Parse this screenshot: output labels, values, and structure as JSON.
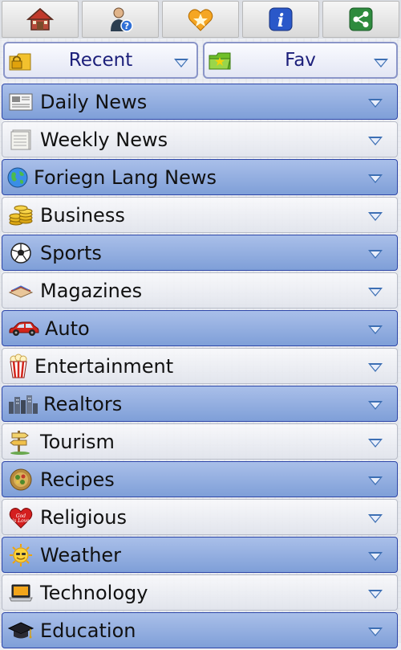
{
  "toolbar": {
    "buttons": [
      {
        "name": "home",
        "icon": "house-icon"
      },
      {
        "name": "help",
        "icon": "person-help-icon"
      },
      {
        "name": "favorites",
        "icon": "star-heart-icon"
      },
      {
        "name": "info",
        "icon": "info-icon"
      },
      {
        "name": "share",
        "icon": "share-icon"
      }
    ]
  },
  "dropdowns": {
    "recent": {
      "label": "Recent",
      "icon": "lock-folder-icon"
    },
    "fav": {
      "label": "Fav",
      "icon": "green-folder-icon"
    }
  },
  "categories": [
    {
      "label": "Daily News",
      "icon": "newspaper-icon"
    },
    {
      "label": "Weekly News",
      "icon": "newspaper-stack-icon"
    },
    {
      "label": "Foriegn Lang News",
      "icon": "globe-icon"
    },
    {
      "label": "Business",
      "icon": "coins-icon"
    },
    {
      "label": "Sports",
      "icon": "soccer-ball-icon"
    },
    {
      "label": "Magazines",
      "icon": "magazine-icon"
    },
    {
      "label": "Auto",
      "icon": "car-icon"
    },
    {
      "label": "Entertainment",
      "icon": "popcorn-icon"
    },
    {
      "label": "Realtors",
      "icon": "city-icon"
    },
    {
      "label": "Tourism",
      "icon": "signpost-icon"
    },
    {
      "label": "Recipes",
      "icon": "food-icon"
    },
    {
      "label": "Religious",
      "icon": "heart-icon"
    },
    {
      "label": "Weather",
      "icon": "sun-icon"
    },
    {
      "label": "Technology",
      "icon": "laptop-icon"
    },
    {
      "label": "Education",
      "icon": "graduation-cap-icon"
    }
  ],
  "colors": {
    "row_dark": "#8fa9de",
    "row_border": "#2d46a8",
    "dropdown_text": "#1c1f7a",
    "caret": "#3d6fb4"
  }
}
